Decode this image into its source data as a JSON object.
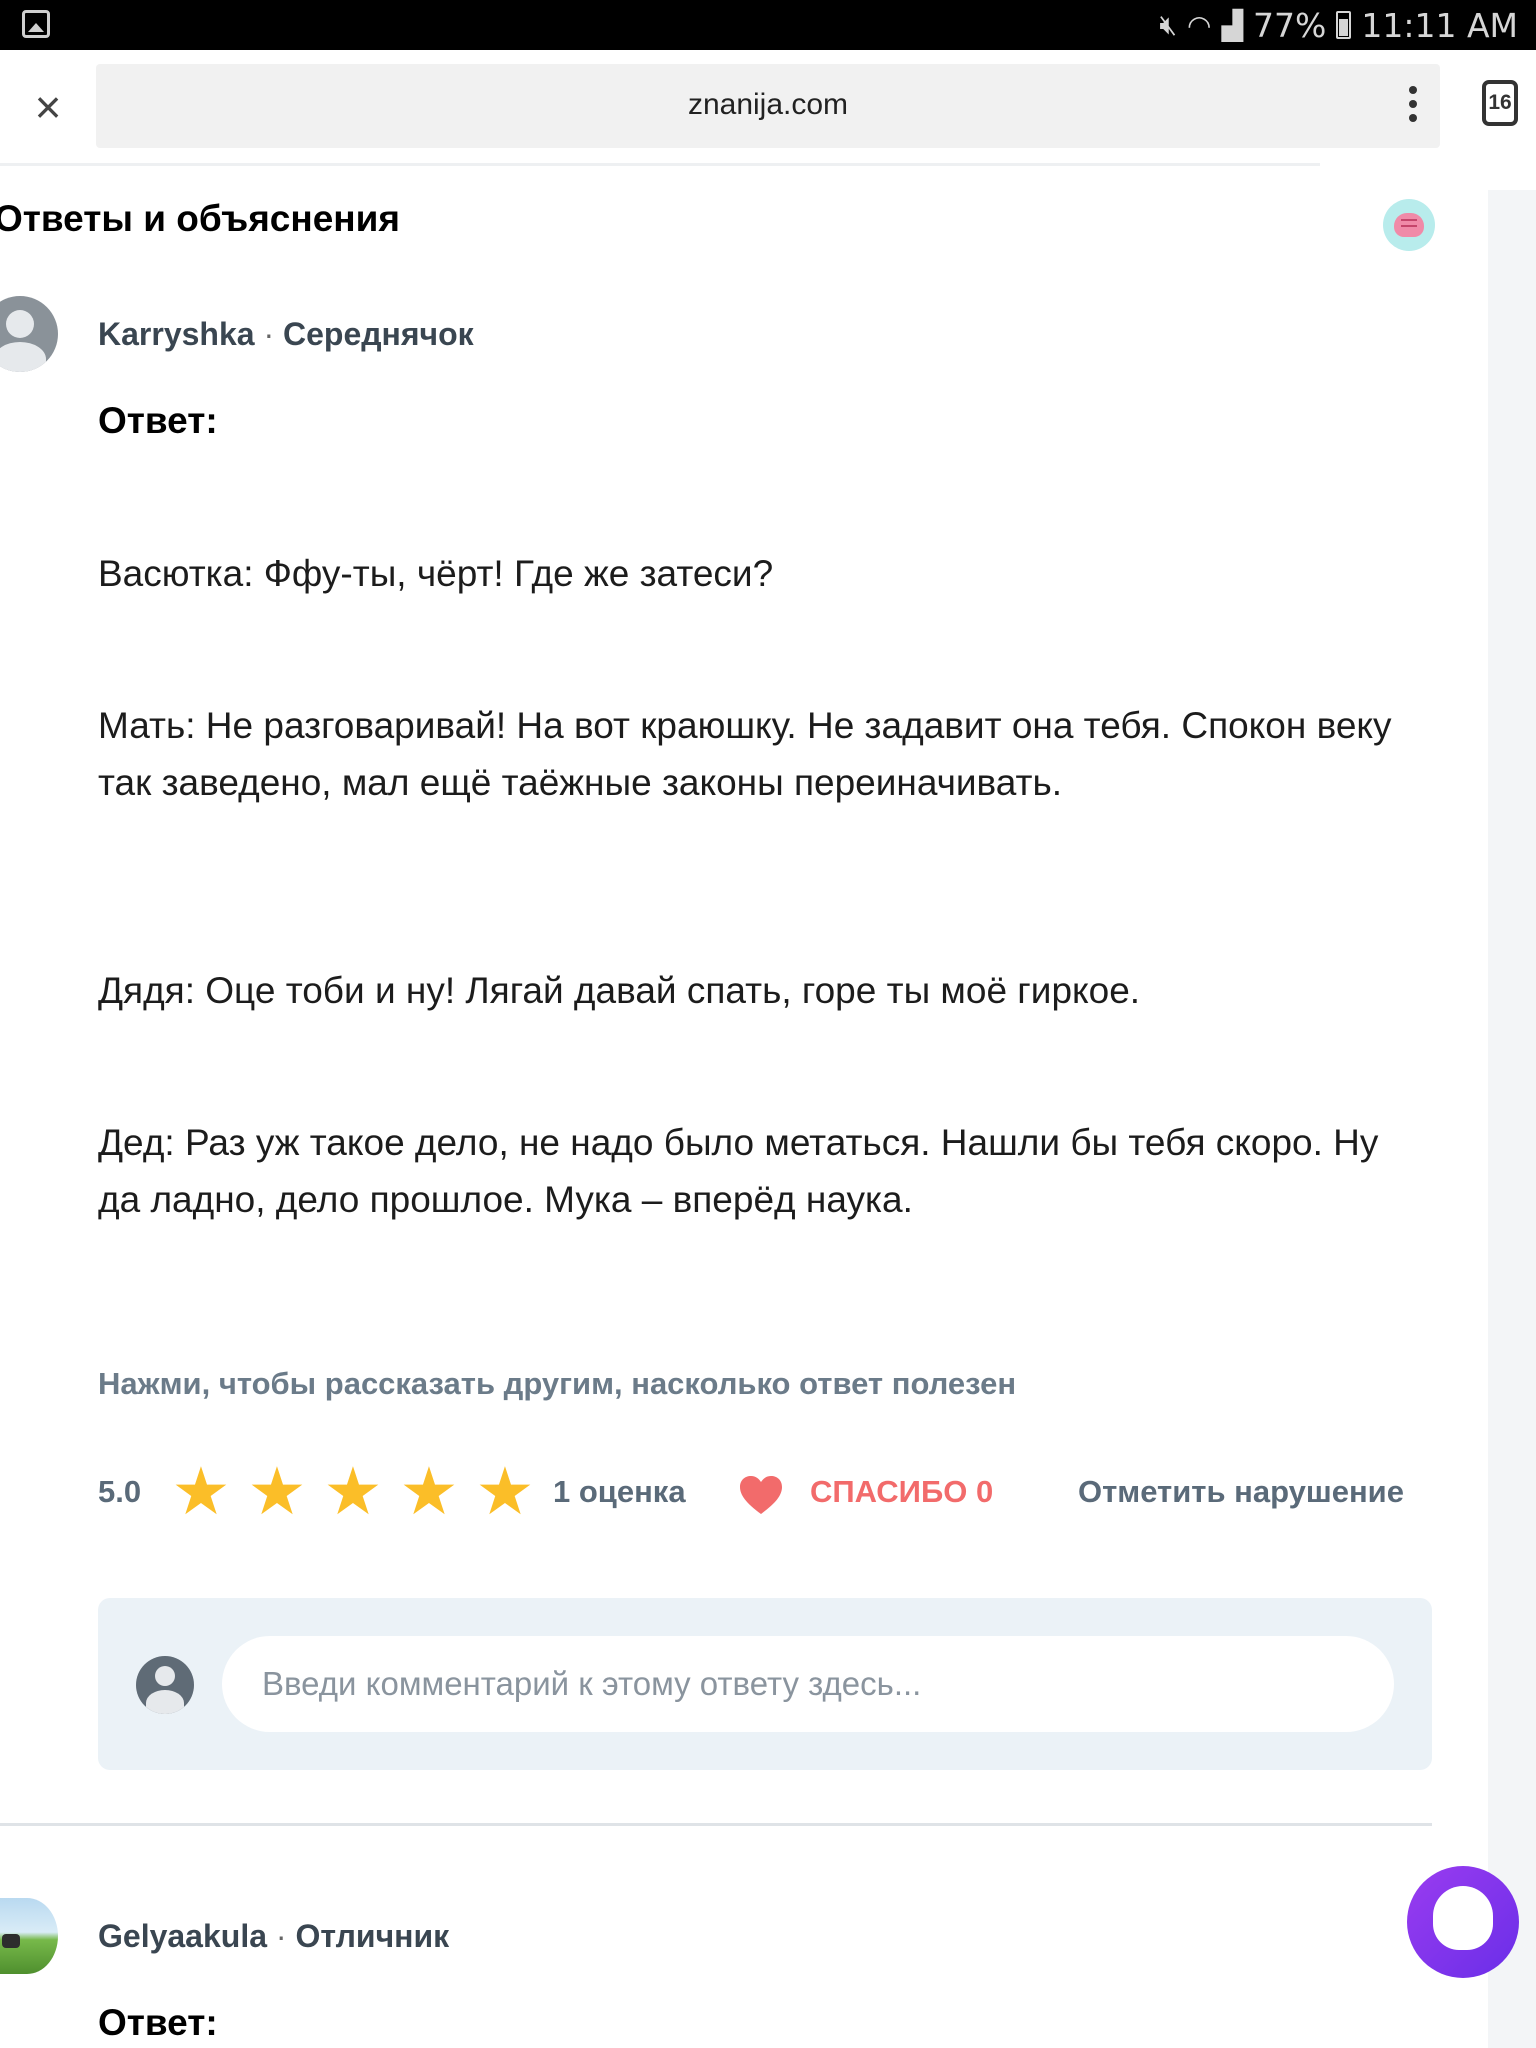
{
  "status_bar": {
    "battery": "77%",
    "time": "11:11 AM",
    "icons": [
      "gallery-icon",
      "mute-icon",
      "wifi-icon",
      "signal-icon",
      "battery-icon"
    ]
  },
  "browser": {
    "url": "znanija.com",
    "tab_count": "16",
    "icons": [
      "close-icon",
      "more-vert-icon",
      "tabs-icon"
    ]
  },
  "section": {
    "title": "Ответы и объяснения"
  },
  "answers": [
    {
      "user": "Karryshka",
      "separator": "·",
      "rank": "Середнячок",
      "label": "Ответ:",
      "paragraphs": [
        "Васютка: Ффу-ты, чёрт! Где же затеси?",
        "Мать: Не разговаривай! На вот краюшку. Не задавит она тебя. Спокон веку так заведено, мал ещё таёжные законы переиначивать.",
        "Дядя: Оце тоби и ну! Лягай давай спать, горе ты моё гиркое.",
        "Дед: Раз уж такое дело, не надо было метаться. Нашли бы тебя скоро. Ну да ладно, дело прошлое. Мука – вперёд наука."
      ],
      "rate_hint": "Нажми, чтобы рассказать другим, насколько ответ полезен",
      "rating": "5.0",
      "stars_filled": 5,
      "rating_count": "1 оценка",
      "thanks": "СПАСИБО 0",
      "report": "Отметить нарушение",
      "comment_placeholder": "Введи комментарий к этому ответу здесь..."
    },
    {
      "user": "Gelyaakula",
      "separator": "·",
      "rank": "Отличник",
      "label": "Ответ:"
    }
  ],
  "colors": {
    "star": "#fbbe28",
    "thanks": "#f26b6b",
    "muted_text": "#5a6a79",
    "comment_bg": "#ebf2f7",
    "fab": "#7a34ec"
  }
}
